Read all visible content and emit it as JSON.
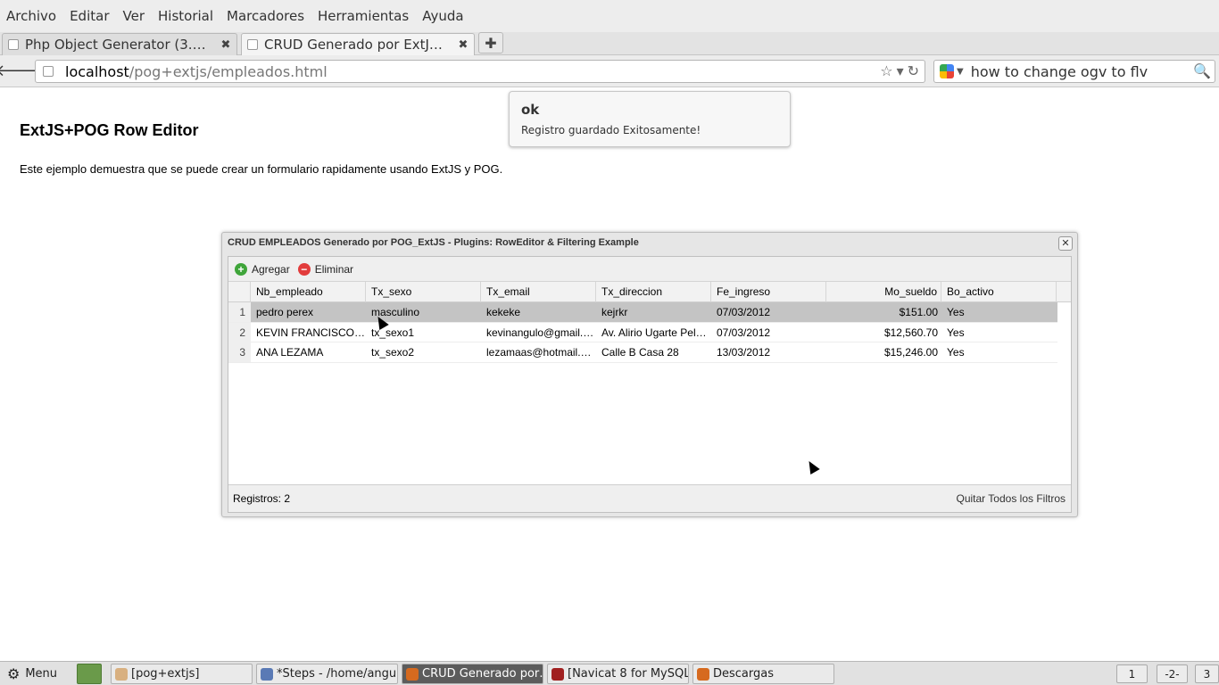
{
  "browser": {
    "menu": [
      "Archivo",
      "Editar",
      "Ver",
      "Historial",
      "Marcadores",
      "Herramientas",
      "Ayuda"
    ],
    "tabs": [
      {
        "title": "Php Object Generator (3.…",
        "close": "✖"
      },
      {
        "title": "CRUD Generado por ExtJ…",
        "close": "✖"
      }
    ],
    "new_tab": "✚",
    "back": "🡐",
    "url_host": "localhost",
    "url_path": "/pog+extjs/empleados.html",
    "url_icons": {
      "star": "☆",
      "drop": "▾",
      "reload": "↻"
    },
    "search_query": "how to change ogv to flv",
    "search_drop": "▼",
    "search_icon": "🔍"
  },
  "page": {
    "heading": "ExtJS+POG Row Editor",
    "description": "Este ejemplo demuestra que se puede crear un formulario rapidamente usando ExtJS y POG."
  },
  "notification": {
    "title": "ok",
    "message": "Registro guardado Exitosamente!"
  },
  "grid": {
    "title": "CRUD EMPLEADOS Generado por POG_ExtJS - Plugins: RowEditor & Filtering Example",
    "close": "✕",
    "toolbar": {
      "add_label": "Agregar",
      "add_icon": "+",
      "delete_label": "Eliminar",
      "delete_icon": "−"
    },
    "columns": [
      "Nb_empleado",
      "Tx_sexo",
      "Tx_email",
      "Tx_direccion",
      "Fe_ingreso",
      "Mo_sueldo",
      "Bo_activo"
    ],
    "rows": [
      {
        "n": "1",
        "nb": "pedro perex",
        "sexo": "masculino",
        "email": "kekeke",
        "dir": "kejrkr",
        "fe": "07/03/2012",
        "sueldo": "$151.00",
        "activo": "Yes"
      },
      {
        "n": "2",
        "nb": "KEVIN FRANCISCO…",
        "sexo": "tx_sexo1",
        "email": "kevinangulo@gmail.…",
        "dir": "Av. Alirio Ugarte Pel…",
        "fe": "07/03/2012",
        "sueldo": "$12,560.70",
        "activo": "Yes"
      },
      {
        "n": "3",
        "nb": "ANA LEZAMA",
        "sexo": "tx_sexo2",
        "email": "lezamaas@hotmail.…",
        "dir": "Calle B Casa 28",
        "fe": "13/03/2012",
        "sueldo": "$15,246.00",
        "activo": "Yes"
      }
    ],
    "footer": {
      "count": "Registros: 2",
      "clear_filters": "Quitar Todos los Filtros"
    }
  },
  "taskbar": {
    "menu": "Menu",
    "menu_icon": "⚙",
    "items": [
      {
        "label": "[pog+extjs]",
        "icon_color": "#d8b080"
      },
      {
        "label": "*Steps - /home/angu…",
        "icon_color": "#5a7ab5"
      },
      {
        "label": "CRUD Generado por…",
        "icon_color": "#d66a1f"
      },
      {
        "label": "[Navicat 8 for MySQL]",
        "icon_color": "#a02020"
      },
      {
        "label": "Descargas",
        "icon_color": "#d66a1f"
      }
    ],
    "workspaces": [
      "1",
      "-2-",
      "3"
    ]
  }
}
